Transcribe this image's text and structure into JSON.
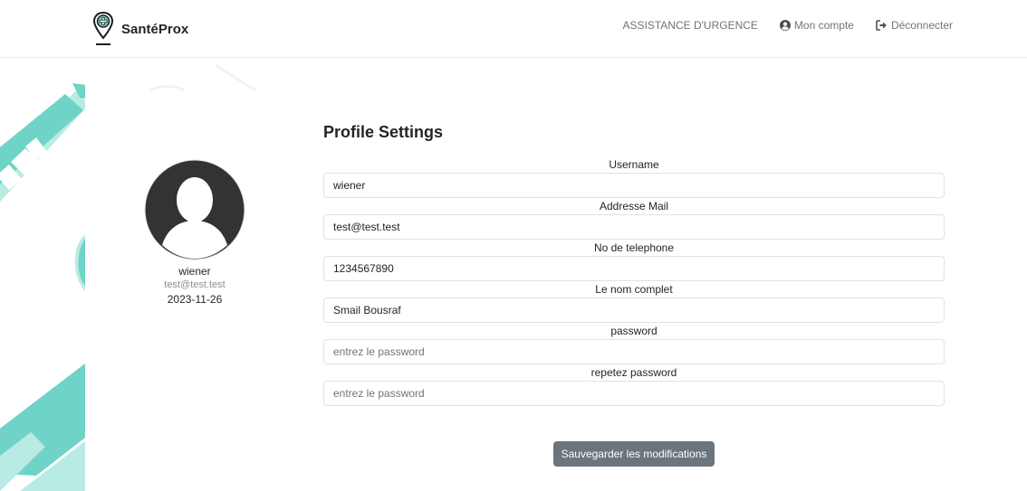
{
  "brand": {
    "name": "SantéProx",
    "logo_icon": "map-pin-medical-icon"
  },
  "nav": {
    "emergency": "ASSISTANCE D'URGENCE",
    "account": "Mon compte",
    "logout": "Déconnecter"
  },
  "profile": {
    "name": "wiener",
    "email": "test@test.test",
    "date": "2023-11-26"
  },
  "settings": {
    "title": "Profile Settings",
    "fields": [
      {
        "label": "Username",
        "value": "wiener",
        "placeholder": ""
      },
      {
        "label": "Addresse Mail",
        "value": "test@test.test",
        "placeholder": ""
      },
      {
        "label": "No de telephone",
        "value": "1234567890",
        "placeholder": ""
      },
      {
        "label": "Le nom complet",
        "value": "Smail Bousraf",
        "placeholder": ""
      },
      {
        "label": "password",
        "value": "",
        "placeholder": "entrez le password"
      },
      {
        "label": "repetez password",
        "value": "",
        "placeholder": "entrez le password"
      }
    ],
    "save_label": "Sauvegarder les modifications"
  },
  "colors": {
    "accent_teal": "#6fd3c7",
    "light_teal": "#b8ebe4",
    "button_gray": "#6c757d",
    "avatar_dark": "#333333"
  }
}
